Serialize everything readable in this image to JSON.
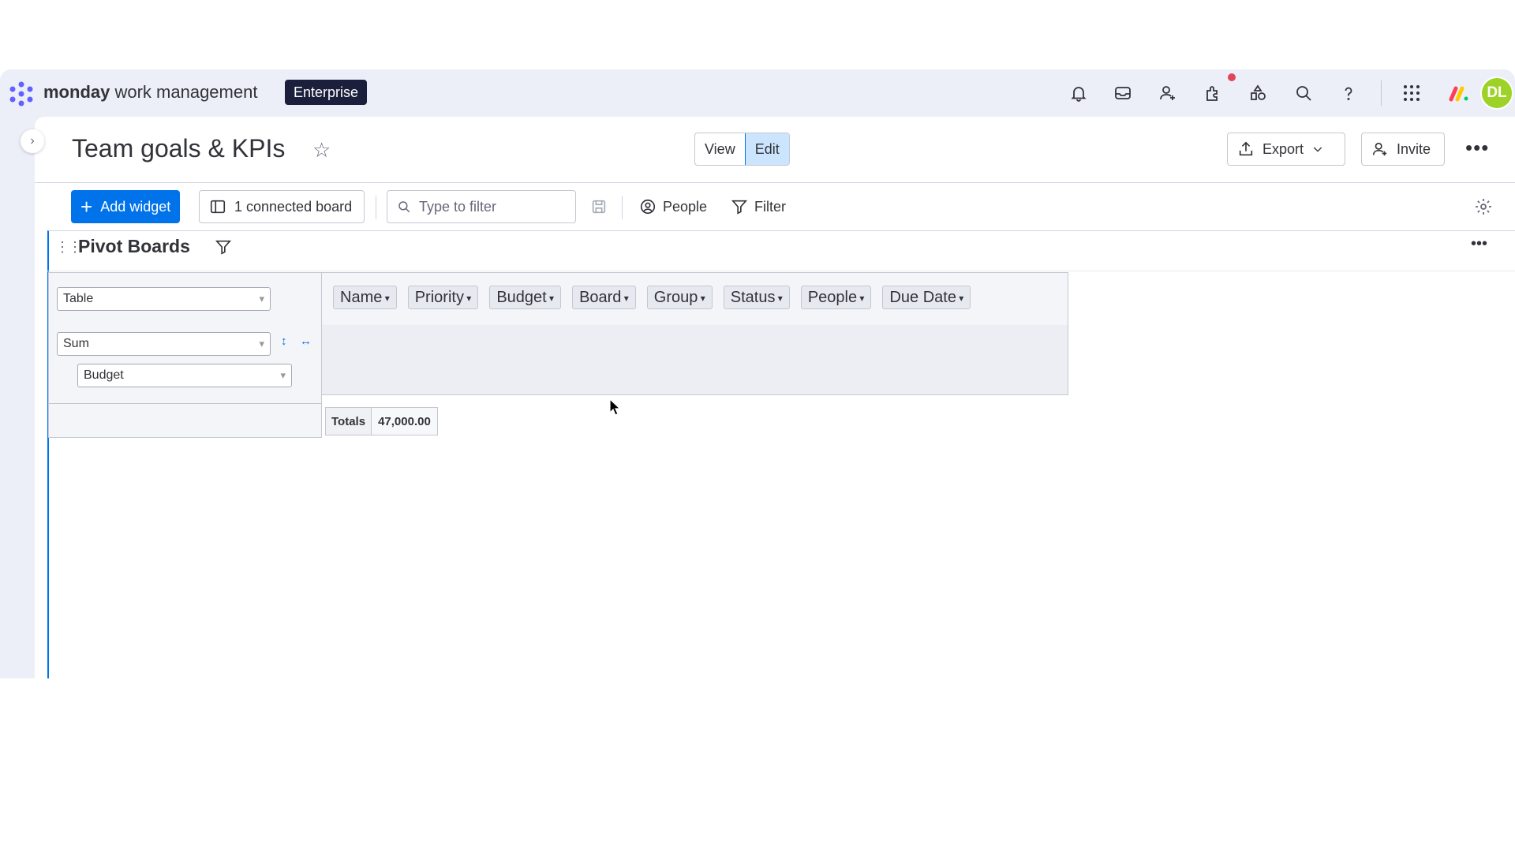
{
  "topbar": {
    "brand_bold": "monday",
    "brand_rest": " work management",
    "plan_badge": "Enterprise",
    "icons": [
      "bell-icon",
      "inbox-icon",
      "invite-members-icon",
      "apps-icon",
      "marketplace-icon",
      "search-icon",
      "help-icon",
      "grid-icon"
    ],
    "avatar_initials": "DL",
    "avatar_color": "#9cd326"
  },
  "header": {
    "title": "Team goals & KPIs",
    "view_label": "View",
    "edit_label": "Edit",
    "export_label": "Export",
    "invite_label": "Invite"
  },
  "toolbar": {
    "add_widget_label": "Add widget",
    "connected_board_label": "1 connected board",
    "filter_placeholder": "Type to filter",
    "people_label": "People",
    "filter_label": "Filter"
  },
  "widget": {
    "title": "Pivot Boards",
    "renderer_select": "Table",
    "aggregator_select": "Sum",
    "aggregator_field_select": "Budget",
    "attributes": [
      "Name",
      "Priority",
      "Budget",
      "Board",
      "Group",
      "Status",
      "People",
      "Due Date"
    ],
    "totals_label": "Totals",
    "totals_value": "47,000.00"
  },
  "colors": {
    "primary": "#0073ea",
    "app_background": "#eceff8",
    "badge_background": "#1c1f3b"
  }
}
